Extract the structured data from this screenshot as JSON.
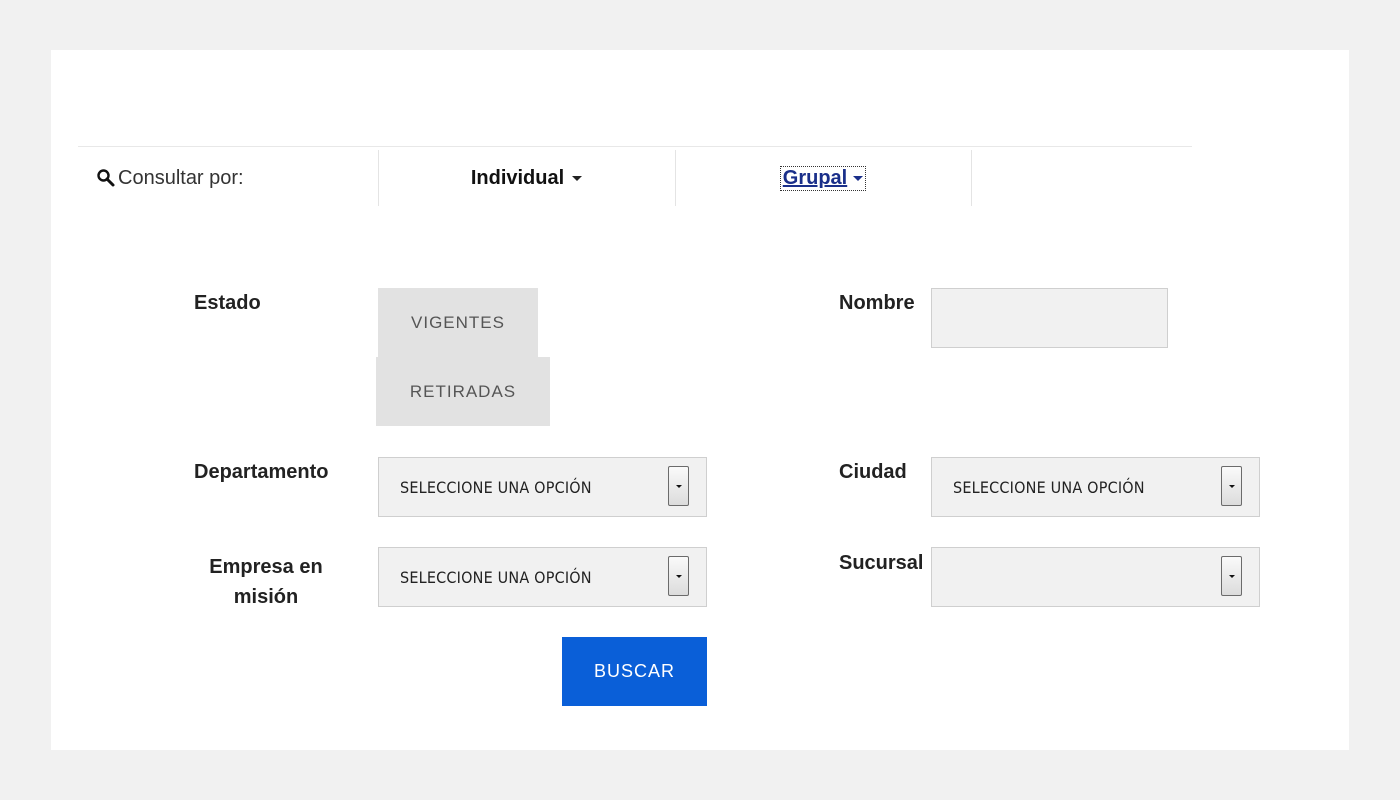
{
  "consult": {
    "label": "Consultar por:",
    "icon": "search-icon",
    "tabs": [
      {
        "label": "Individual",
        "style": "bold"
      },
      {
        "label": "Grupal",
        "style": "link"
      }
    ]
  },
  "form": {
    "estado": {
      "label": "Estado",
      "options": [
        "VIGENTES",
        "RETIRADAS"
      ]
    },
    "nombre": {
      "label": "Nombre",
      "value": ""
    },
    "departamento": {
      "label": "Departamento",
      "value": "SELECCIONE UNA OPCIÓN"
    },
    "ciudad": {
      "label": "Ciudad",
      "value": "SELECCIONE UNA OPCIÓN"
    },
    "empresa": {
      "label_line1": "Empresa en",
      "label_line2": "misión",
      "value": "SELECCIONE UNA OPCIÓN"
    },
    "sucursal": {
      "label": "Sucursal",
      "value": ""
    },
    "submit_label": "BUSCAR"
  },
  "colors": {
    "accent": "#0a5fd8",
    "link": "#1a2f8a",
    "background": "#f1f1f1",
    "toggle": "#e2e2e2"
  }
}
